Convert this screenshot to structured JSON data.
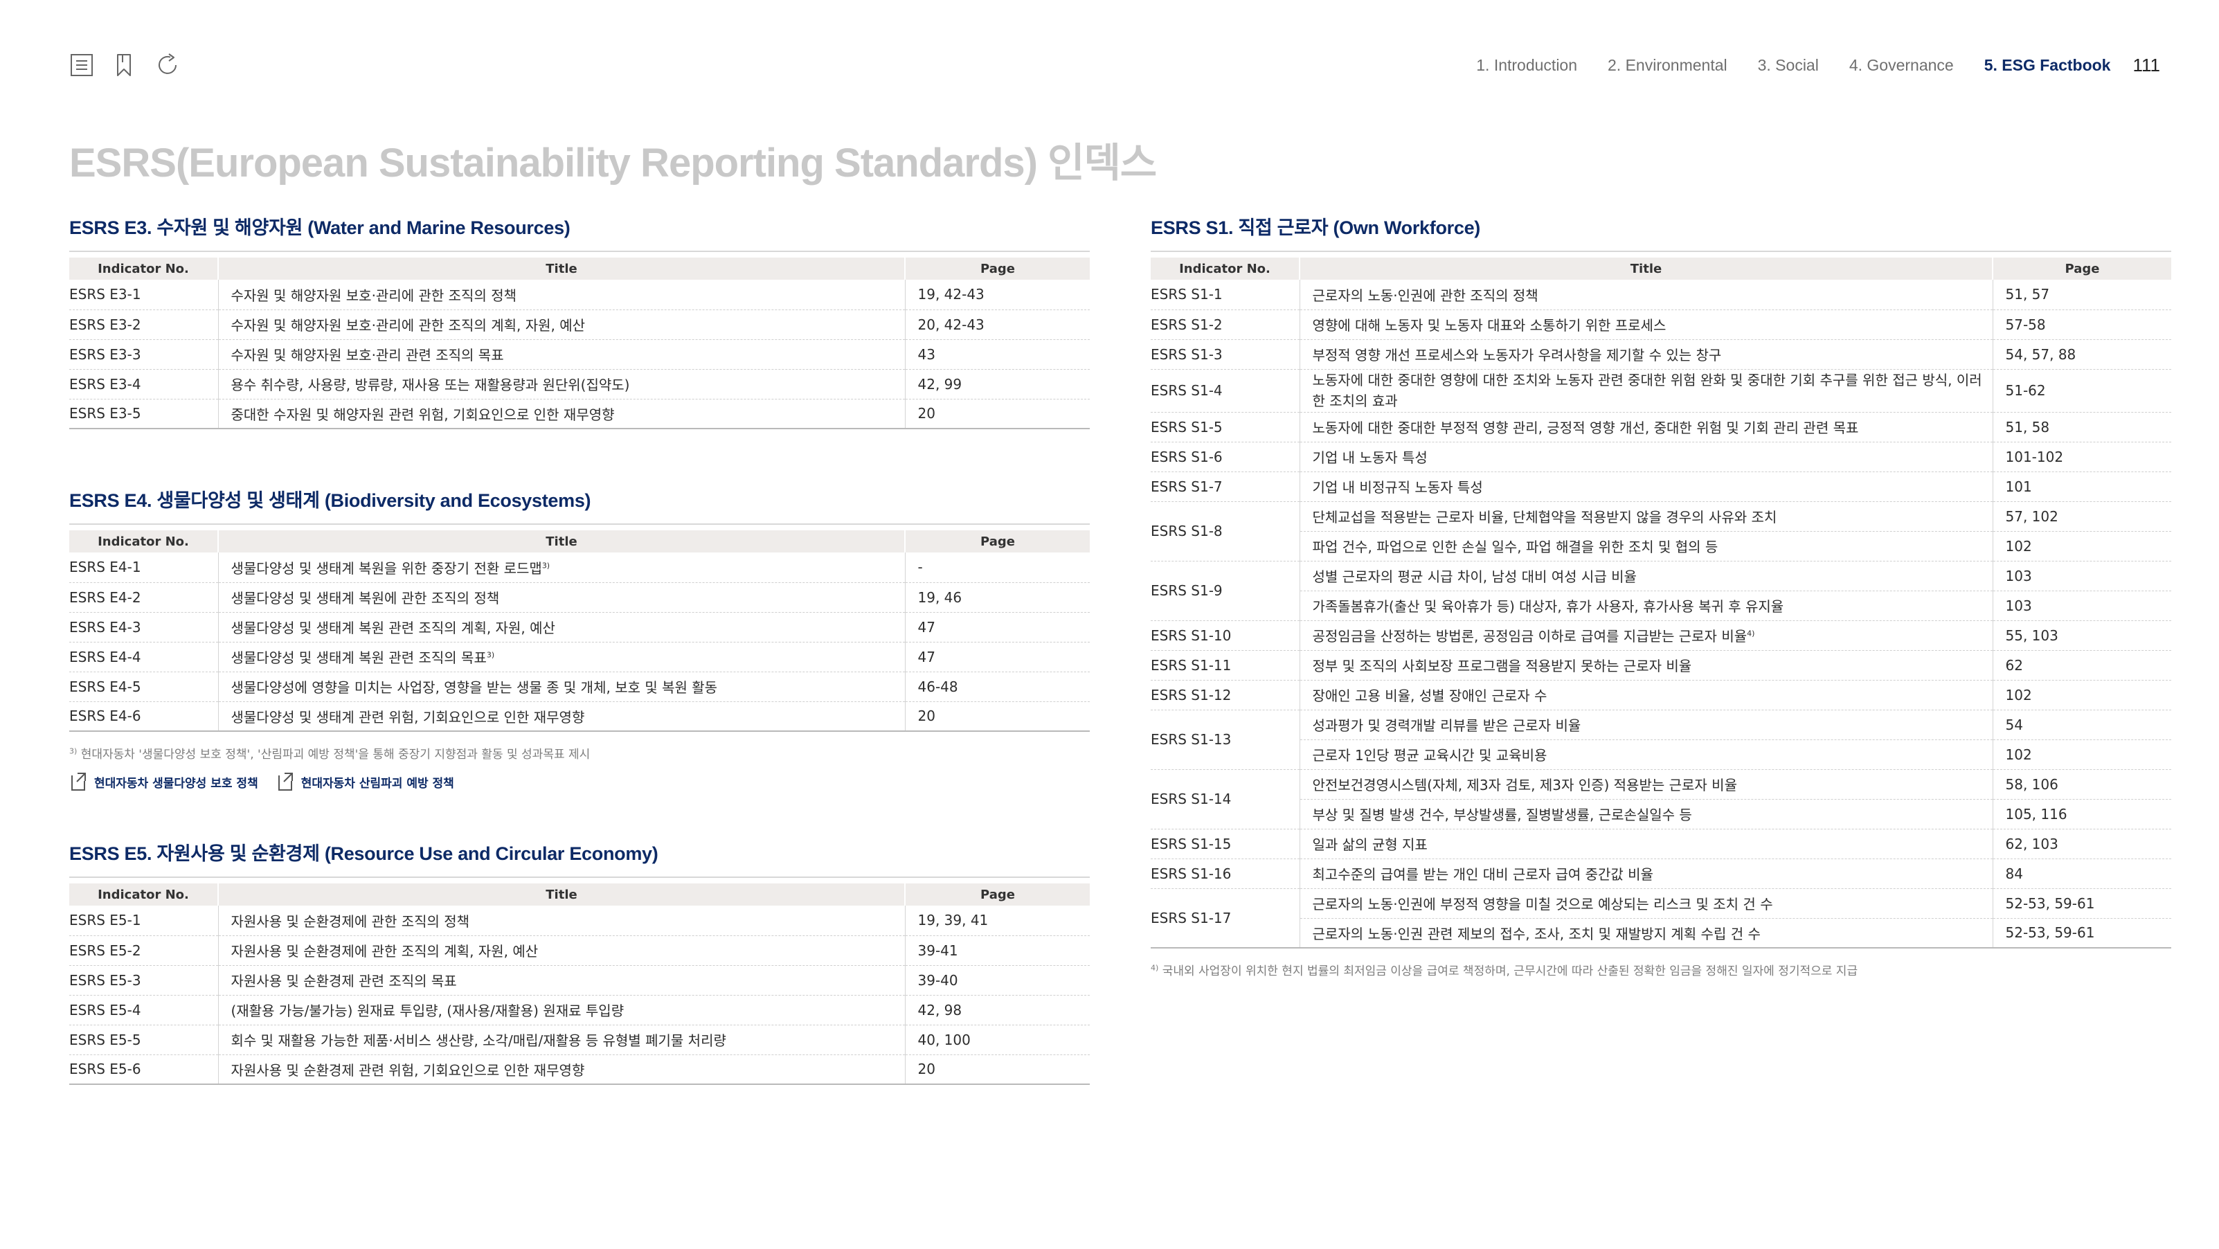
{
  "header": {
    "nav": [
      {
        "label": "1. Introduction",
        "active": false
      },
      {
        "label": "2. Environmental",
        "active": false
      },
      {
        "label": "3. Social",
        "active": false
      },
      {
        "label": "4. Governance",
        "active": false
      },
      {
        "label": "5. ESG Factbook",
        "active": true
      }
    ],
    "page_number": "111",
    "icons": [
      "list-icon",
      "bookmark-icon",
      "refresh-icon"
    ]
  },
  "page_title": "ESRS(European Sustainability Reporting Standards) 인덱스",
  "columns": {
    "indicator": "Indicator No.",
    "title": "Title",
    "page": "Page"
  },
  "e3": {
    "heading": "ESRS E3. 수자원 및 해양자원 (Water and Marine Resources)",
    "rows": [
      {
        "id": "ESRS E3-1",
        "title": "수자원 및 해양자원 보호·관리에 관한 조직의 정책",
        "page": "19, 42-43"
      },
      {
        "id": "ESRS E3-2",
        "title": "수자원 및 해양자원 보호·관리에 관한 조직의 계획, 자원, 예산",
        "page": "20, 42-43"
      },
      {
        "id": "ESRS E3-3",
        "title": "수자원 및 해양자원 보호·관리 관련 조직의 목표",
        "page": "43"
      },
      {
        "id": "ESRS E3-4",
        "title": "용수 취수량, 사용량, 방류량, 재사용 또는 재활용량과 원단위(집약도)",
        "page": "42, 99"
      },
      {
        "id": "ESRS E3-5",
        "title": "중대한 수자원 및 해양자원 관련 위험, 기회요인으로 인한 재무영향",
        "page": "20"
      }
    ]
  },
  "e4": {
    "heading": "ESRS E4. 생물다양성 및 생태계 (Biodiversity and Ecosystems)",
    "rows": [
      {
        "id": "ESRS E4-1",
        "title": "생물다양성 및 생태계 복원을 위한 중장기 전환 로드맵",
        "sup": "3)",
        "page": "-"
      },
      {
        "id": "ESRS E4-2",
        "title": "생물다양성 및 생태계 복원에 관한 조직의 정책",
        "page": "19, 46"
      },
      {
        "id": "ESRS E4-3",
        "title": "생물다양성 및 생태계 복원 관련 조직의 계획, 자원, 예산",
        "page": "47"
      },
      {
        "id": "ESRS E4-4",
        "title": "생물다양성 및 생태계 복원 관련 조직의 목표",
        "sup": "3)",
        "page": "47"
      },
      {
        "id": "ESRS E4-5",
        "title": "생물다양성에 영향을 미치는 사업장, 영향을 받는 생물 종 및 개체, 보호 및 복원 활동",
        "page": "46-48"
      },
      {
        "id": "ESRS E4-6",
        "title": "생물다양성 및 생태계 관련 위험, 기회요인으로 인한 재무영향",
        "page": "20"
      }
    ],
    "footnote_mark": "3)",
    "footnote": " 현대자동차 '생물다양성 보호 정책', '산림파괴 예방 정책'을 통해 중장기 지향점과 활동 및 성과목표 제시",
    "links": [
      "현대자동차 생물다양성 보호 정책",
      "현대자동차 산림파괴 예방 정책"
    ]
  },
  "e5": {
    "heading": "ESRS E5. 자원사용 및 순환경제 (Resource Use and Circular Economy)",
    "rows": [
      {
        "id": "ESRS E5-1",
        "title": "자원사용 및 순환경제에 관한 조직의 정책",
        "page": "19, 39, 41"
      },
      {
        "id": "ESRS E5-2",
        "title": "자원사용 및 순환경제에 관한 조직의 계획, 자원, 예산",
        "page": "39-41"
      },
      {
        "id": "ESRS E5-3",
        "title": "자원사용 및 순환경제 관련 조직의 목표",
        "page": "39-40"
      },
      {
        "id": "ESRS E5-4",
        "title": "(재활용 가능/불가능) 원재료 투입량, (재사용/재활용) 원재료 투입량",
        "page": "42, 98"
      },
      {
        "id": "ESRS E5-5",
        "title": "회수 및 재활용 가능한 제품·서비스 생산량, 소각/매립/재활용 등 유형별 폐기물 처리량",
        "page": "40, 100"
      },
      {
        "id": "ESRS E5-6",
        "title": "자원사용 및 순환경제 관련 위험, 기회요인으로 인한 재무영향",
        "page": "20"
      }
    ]
  },
  "s1": {
    "heading": "ESRS S1. 직접 근로자 (Own Workforce)",
    "rows": [
      {
        "id": "ESRS S1-1",
        "items": [
          {
            "title": "근로자의 노동·인권에 관한 조직의 정책",
            "page": "51, 57"
          }
        ]
      },
      {
        "id": "ESRS S1-2",
        "items": [
          {
            "title": "영향에 대해 노동자 및 노동자 대표와 소통하기 위한 프로세스",
            "page": "57-58"
          }
        ]
      },
      {
        "id": "ESRS S1-3",
        "items": [
          {
            "title": "부정적 영향 개선 프로세스와 노동자가 우려사항을 제기할 수 있는 창구",
            "page": "54, 57, 88"
          }
        ]
      },
      {
        "id": "ESRS S1-4",
        "items": [
          {
            "title": "노동자에 대한 중대한 영향에 대한 조치와 노동자 관련 중대한 위험 완화 및 중대한 기회 추구를 위한 접근 방식, 이러한 조치의 효과",
            "page": "51-62",
            "wrap": true
          }
        ]
      },
      {
        "id": "ESRS S1-5",
        "items": [
          {
            "title": "노동자에 대한 중대한 부정적 영향 관리, 긍정적 영향 개선, 중대한 위험 및 기회 관리 관련 목표",
            "page": "51, 58"
          }
        ]
      },
      {
        "id": "ESRS S1-6",
        "items": [
          {
            "title": "기업 내 노동자 특성",
            "page": "101-102"
          }
        ]
      },
      {
        "id": "ESRS S1-7",
        "items": [
          {
            "title": "기업 내 비정규직 노동자 특성",
            "page": "101"
          }
        ]
      },
      {
        "id": "ESRS S1-8",
        "items": [
          {
            "title": "단체교섭을 적용받는 근로자 비율, 단체협약을 적용받지 않을 경우의 사유와 조치",
            "page": "57, 102"
          },
          {
            "title": "파업 건수, 파업으로 인한 손실 일수, 파업 해결을 위한 조치 및 협의 등",
            "page": "102"
          }
        ]
      },
      {
        "id": "ESRS S1-9",
        "items": [
          {
            "title": "성별 근로자의 평균 시급 차이, 남성 대비 여성 시급 비율",
            "page": "103"
          },
          {
            "title": "가족돌봄휴가(출산 및 육아휴가 등) 대상자, 휴가 사용자, 휴가사용 복귀 후 유지율",
            "page": "103"
          }
        ]
      },
      {
        "id": "ESRS S1-10",
        "items": [
          {
            "title": "공정임금을 산정하는 방법론, 공정임금 이하로 급여를 지급받는 근로자 비율",
            "sup": "4)",
            "page": "55, 103"
          }
        ]
      },
      {
        "id": "ESRS S1-11",
        "items": [
          {
            "title": "정부 및 조직의 사회보장 프로그램을 적용받지 못하는 근로자 비율",
            "page": "62"
          }
        ]
      },
      {
        "id": "ESRS S1-12",
        "items": [
          {
            "title": "장애인 고용 비율, 성별 장애인 근로자 수",
            "page": "102"
          }
        ]
      },
      {
        "id": "ESRS S1-13",
        "items": [
          {
            "title": "성과평가 및 경력개발 리뷰를 받은 근로자 비율",
            "page": "54"
          },
          {
            "title": "근로자 1인당 평균 교육시간 및 교육비용",
            "page": "102"
          }
        ]
      },
      {
        "id": "ESRS S1-14",
        "items": [
          {
            "title": "안전보건경영시스템(자체, 제3자 검토, 제3자 인증) 적용받는 근로자 비율",
            "page": "58, 106"
          },
          {
            "title": "부상 및 질병 발생 건수, 부상발생률, 질병발생률, 근로손실일수 등",
            "page": "105, 116"
          }
        ]
      },
      {
        "id": "ESRS S1-15",
        "items": [
          {
            "title": "일과 삶의 균형 지표",
            "page": "62, 103"
          }
        ]
      },
      {
        "id": "ESRS S1-16",
        "items": [
          {
            "title": "최고수준의 급여를 받는 개인 대비 근로자 급여 중간값 비율",
            "page": "84"
          }
        ]
      },
      {
        "id": "ESRS S1-17",
        "items": [
          {
            "title": "근로자의 노동·인권에 부정적 영향을 미칠 것으로 예상되는 리스크 및 조치 건 수",
            "page": "52-53, 59-61"
          },
          {
            "title": "근로자의 노동·인권 관련 제보의 접수, 조사, 조치 및 재발방지 계획 수립 건 수",
            "page": "52-53, 59-61"
          }
        ]
      }
    ],
    "footnote_mark": "4)",
    "footnote": " 국내외 사업장이 위치한 현지 법률의 최저임금 이상을 급여로 책정하며, 근무시간에 따라 산출된 정확한 임금을 정해진 일자에 정기적으로 지급"
  }
}
